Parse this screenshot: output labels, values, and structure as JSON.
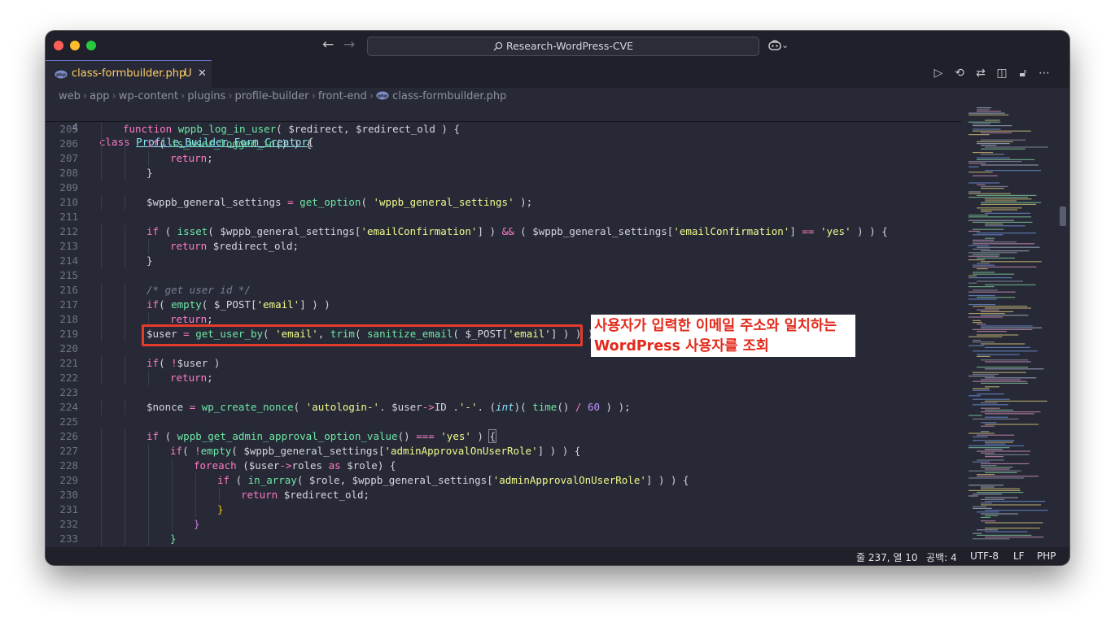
{
  "window": {
    "title": "Research-WordPress-CVE",
    "nav_back": "←",
    "nav_forward": "→",
    "copilot_menu": "⌄"
  },
  "tab": {
    "filename": "class-formbuilder.php",
    "status": "U",
    "close": "✕"
  },
  "toolbar_icons": [
    "run-icon",
    "timeline-icon",
    "compare-icon",
    "split-editor-icon",
    "lock-icon",
    "more-icon"
  ],
  "toolbar_glyphs": [
    "▷",
    "⟲",
    "⇄",
    "◫",
    "🔓︎",
    "⋯"
  ],
  "breadcrumb": [
    "web",
    "app",
    "wp-content",
    "plugins",
    "profile-builder",
    "front-end",
    "class-formbuilder.php"
  ],
  "sticky_line": {
    "number": "4",
    "keyword": "class",
    "name": "Profile_Builder_Form_Creator",
    "brace": "{"
  },
  "code_lines": [
    {
      "n": "205",
      "indent": 1,
      "html": "<span class='k'>function</span> <span class='f'>wppb_log_in_user</span>( <span class='v'>$redirect</span>, <span class='v'>$redirect_old</span> ) {"
    },
    {
      "n": "206",
      "indent": 2,
      "html": "<span class='k'>if</span>( <span class='f'>is_user_logged_in</span>() ) {"
    },
    {
      "n": "207",
      "indent": 3,
      "html": "<span class='k'>return</span>;"
    },
    {
      "n": "208",
      "indent": 2,
      "html": "}"
    },
    {
      "n": "209",
      "indent": 0,
      "html": ""
    },
    {
      "n": "210",
      "indent": 2,
      "html": "<span class='v'>$wppb_general_settings</span> <span class='k'>=</span> <span class='f'>get_option</span>( <span class='s'>'wppb_general_settings'</span> );"
    },
    {
      "n": "211",
      "indent": 0,
      "html": ""
    },
    {
      "n": "212",
      "indent": 2,
      "html": "<span class='k'>if</span> ( <span class='f'>isset</span>( <span class='v'>$wppb_general_settings</span>[<span class='s'>'emailConfirmation'</span>] ) <span class='k'>&amp;&amp;</span> ( <span class='v'>$wppb_general_settings</span>[<span class='s'>'emailConfirmation'</span>] <span class='k'>==</span> <span class='s'>'yes'</span> ) ) {"
    },
    {
      "n": "213",
      "indent": 3,
      "html": "<span class='k'>return</span> <span class='v'>$redirect_old</span>;"
    },
    {
      "n": "214",
      "indent": 2,
      "html": "}"
    },
    {
      "n": "215",
      "indent": 0,
      "html": ""
    },
    {
      "n": "216",
      "indent": 2,
      "html": "<span class='c'>/* get user id */</span>"
    },
    {
      "n": "217",
      "indent": 2,
      "html": "<span class='k'>if</span>( <span class='f'>empty</span>( <span class='v'>$_POST</span>[<span class='s'>'email'</span>] ) )"
    },
    {
      "n": "218",
      "indent": 3,
      "html": "<span class='k'>return</span>;"
    },
    {
      "n": "219",
      "indent": 2,
      "html": "<span class='v'>$user</span> <span class='k'>=</span> <span class='f'>get_user_by</span>( <span class='s'>'email'</span>, <span class='f'>trim</span>( <span class='f'>sanitize_email</span>( <span class='v'>$_POST</span>[<span class='s'>'email'</span>] ) ) );"
    },
    {
      "n": "220",
      "indent": 0,
      "html": ""
    },
    {
      "n": "221",
      "indent": 2,
      "html": "<span class='k'>if</span>( <span class='k'>!</span><span class='v'>$user</span> )"
    },
    {
      "n": "222",
      "indent": 3,
      "html": "<span class='k'>return</span>;"
    },
    {
      "n": "223",
      "indent": 0,
      "html": ""
    },
    {
      "n": "224",
      "indent": 2,
      "html": "<span class='v'>$nonce</span> <span class='k'>=</span> <span class='f'>wp_create_nonce</span>( <span class='s'>'autologin-'</span>. <span class='v'>$user</span><span class='k'>-&gt;</span>ID .<span class='s'>'-'</span>. (<span class='i'>int</span>)( <span class='f'>time</span>() <span class='k'>/</span> <span class='n'>60</span> ) );"
    },
    {
      "n": "225",
      "indent": 0,
      "html": ""
    },
    {
      "n": "226",
      "indent": 2,
      "html": "<span class='k'>if</span> ( <span class='f'>wppb_get_admin_approval_option_value</span>() <span class='k'>===</span> <span class='s'>'yes'</span> ) <span style='outline:1px solid #8a8c99'>{</span>"
    },
    {
      "n": "227",
      "indent": 3,
      "html": "<span class='k'>if</span>( <span class='k'>!</span><span class='f'>empty</span>( <span class='v'>$wppb_general_settings</span>[<span class='s'>'adminApprovalOnUserRole'</span>] ) ) {"
    },
    {
      "n": "228",
      "indent": 4,
      "html": "<span class='k'>foreach</span> (<span class='v'>$user</span><span class='k'>-&gt;</span>roles <span class='k'>as</span> <span class='v'>$role</span>) {"
    },
    {
      "n": "229",
      "indent": 5,
      "html": "<span class='k'>if</span> ( <span class='f'>in_array</span>( <span class='v'>$role</span>, <span class='v'>$wppb_general_settings</span>[<span class='s'>'adminApprovalOnUserRole'</span>] ) ) {"
    },
    {
      "n": "230",
      "indent": 6,
      "html": "<span class='k'>return</span> <span class='v'>$redirect_old</span>;"
    },
    {
      "n": "231",
      "indent": 5,
      "html": "<span style='color:#f1c40f'>}</span>"
    },
    {
      "n": "232",
      "indent": 4,
      "html": "<span style='color:#c678dd'>}</span>"
    },
    {
      "n": "233",
      "indent": 3,
      "html": "<span style='color:#6ee7a6'>}</span>"
    }
  ],
  "annotation": {
    "line1": "사용자가 입력한 이메일 주소와 일치하는",
    "line2": "WordPress 사용자를 조회"
  },
  "status_bar": {
    "position": "줄 237, 열 10",
    "indent": "공백: 4",
    "encoding": "UTF-8",
    "eol": "LF",
    "language": "PHP"
  },
  "colors": {
    "editor_bg": "#272a36",
    "chrome_bg": "#1f2029",
    "highlight_red": "#e53b2c",
    "tab_text": "#ffcc66"
  }
}
